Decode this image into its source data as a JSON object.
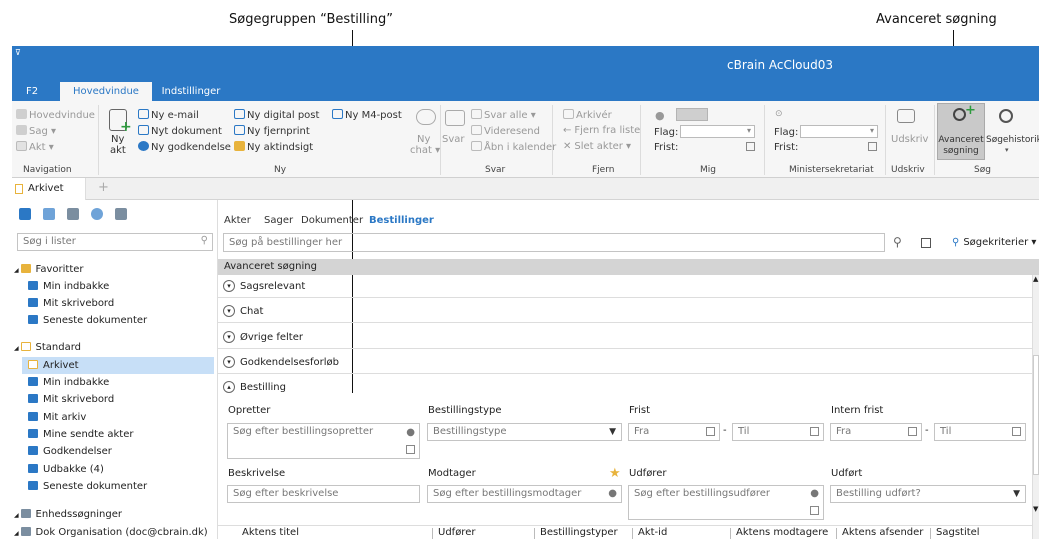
{
  "annotations": {
    "left": "Søgegruppen “Bestilling”",
    "right": "Avanceret søgning"
  },
  "window": {
    "title": "cBrain AcCloud03",
    "quick": "⊽"
  },
  "ribbon_tabs": [
    "F2",
    "Hovedvindue",
    "Indstillinger"
  ],
  "ribbon": {
    "navigation": {
      "items": [
        "Hovedvindue",
        "Sag ▾",
        "Akt ▾"
      ],
      "label": "Navigation"
    },
    "ny": {
      "big": "Ny",
      "big2": "akt",
      "col1": [
        "Ny e-mail",
        "Nyt dokument",
        "Ny godkendelse"
      ],
      "col2": [
        "Ny digital post",
        "Ny fjernprint",
        "Ny aktindsigt"
      ],
      "col3": "Ny M4-post",
      "chat": "Ny",
      "chat2": "chat ▾",
      "label": "Ny"
    },
    "svar": {
      "big": "Svar",
      "items": [
        "Svar alle ▾",
        "Videresend",
        "Åbn i kalender"
      ],
      "label": "Svar"
    },
    "fjern": {
      "items": [
        "Arkivér",
        "Fjern fra liste",
        "Slet akter ▾"
      ],
      "label": "Fjern"
    },
    "mig": {
      "flag": "Flag:",
      "frist": "Frist:",
      "label": "Mig"
    },
    "minister": {
      "flag": "Flag:",
      "frist": "Frist:",
      "label": "Ministersekretariat"
    },
    "udskriv": {
      "big": "Udskriv",
      "label": "Udskriv"
    },
    "sog": {
      "adv1": "Avanceret",
      "adv2": "søgning",
      "hist": "Søgehistorik",
      "label": "Søg"
    }
  },
  "doc_tab": "Arkivet",
  "sidebar": {
    "search_placeholder": "Søg i lister",
    "tree": [
      {
        "t": "Favoritter",
        "lvl": 0,
        "grp": true
      },
      {
        "t": "Min indbakke",
        "lvl": 1
      },
      {
        "t": "Mit skrivebord",
        "lvl": 1
      },
      {
        "t": "Seneste dokumenter",
        "lvl": 1
      },
      {
        "t": "Standard",
        "lvl": 0,
        "grp": true
      },
      {
        "t": "Arkivet",
        "lvl": 1,
        "sel": true
      },
      {
        "t": "Min indbakke",
        "lvl": 1
      },
      {
        "t": "Mit skrivebord",
        "lvl": 1
      },
      {
        "t": "Mit arkiv",
        "lvl": 1
      },
      {
        "t": "Mine sendte akter",
        "lvl": 1
      },
      {
        "t": "Godkendelser",
        "lvl": 1
      },
      {
        "t": "Udbakke (4)",
        "lvl": 1
      },
      {
        "t": "Seneste dokumenter",
        "lvl": 1
      },
      {
        "t": "Enhedssøgninger",
        "lvl": 0,
        "grp": true
      },
      {
        "t": "Dok Organisation (doc@cbrain.dk)",
        "lvl": 0,
        "grp": true
      }
    ]
  },
  "main": {
    "tabs": [
      "Akter",
      "Sager",
      "Dokumenter",
      "Bestillinger"
    ],
    "search_placeholder": "Søg på bestillinger her",
    "kriterier": "Søgekriterier ▾",
    "adv_header": "Avanceret søgning",
    "sections": [
      "Sagsrelevant",
      "Chat",
      "Øvrige felter",
      "Godkendelsesforløb",
      "Bestilling"
    ],
    "fields": {
      "opretter": {
        "label": "Opretter",
        "ph": "Søg efter bestillingsopretter"
      },
      "type": {
        "label": "Bestillingstype",
        "ph": "Bestillingstype"
      },
      "frist": {
        "label": "Frist",
        "fra": "Fra",
        "til": "Til"
      },
      "intern": {
        "label": "Intern frist",
        "fra": "Fra",
        "til": "Til"
      },
      "beskrivelse": {
        "label": "Beskrivelse",
        "ph": "Søg efter beskrivelse"
      },
      "modtager": {
        "label": "Modtager",
        "ph": "Søg efter bestillingsmodtager"
      },
      "udforer": {
        "label": "Udfører",
        "ph": "Søg efter bestillingsudfører"
      },
      "udfort": {
        "label": "Udført",
        "ph": "Bestilling udført?"
      },
      "dash": "-"
    },
    "columns": [
      "Aktens titel",
      "Udfører",
      "Bestillingstyper",
      "Akt-id",
      "Aktens modtagere",
      "Aktens afsender",
      "Sagstitel"
    ]
  },
  "colors": {
    "accent": "#2b78c5",
    "selected": "#c7dff7"
  }
}
